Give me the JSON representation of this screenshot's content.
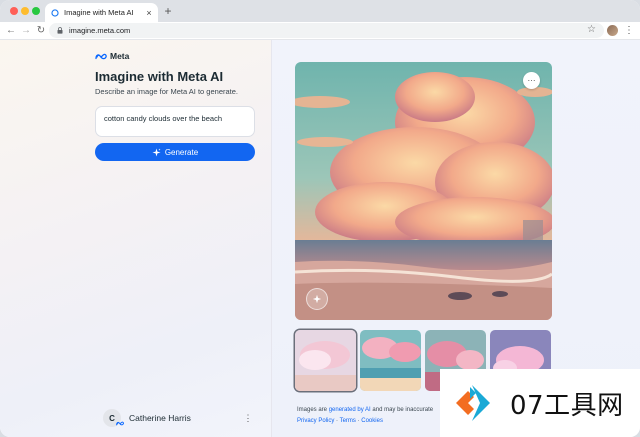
{
  "browser": {
    "tab_title": "Imagine with Meta AI",
    "tab_close": "×",
    "new_tab": "+",
    "url": "imagine.meta.com",
    "nav": {
      "back": "←",
      "forward": "→",
      "reload": "↻"
    },
    "star": "☆",
    "menu": "⋮"
  },
  "sidebar": {
    "logo_text": "Meta",
    "heading": "Imagine with Meta AI",
    "subtitle": "Describe an image for Meta AI to generate.",
    "prompt_value": "cotton candy clouds over the beach",
    "generate_label": "Generate",
    "user": {
      "initial": "C",
      "name": "Catherine Harris",
      "menu": "⋮"
    }
  },
  "viewer": {
    "more_label": "···",
    "thumbnails": [
      {
        "name": "thumbnail-1",
        "selected": true
      },
      {
        "name": "thumbnail-2",
        "selected": false
      },
      {
        "name": "thumbnail-3",
        "selected": false
      },
      {
        "name": "thumbnail-4",
        "selected": false
      }
    ],
    "disclaimer_pre": "Images are ",
    "disclaimer_link": "generated by AI",
    "disclaimer_post": " and may be inaccurate",
    "links": [
      "Privacy Policy",
      "Terms",
      "Cookies"
    ],
    "link_sep": " · "
  },
  "overlay_watermark": {
    "text": "07工具网"
  },
  "colors": {
    "accent": "#1266f1",
    "text": "#1c2b33"
  },
  "icons": [
    "meta-logo-icon",
    "lock-icon",
    "sparkle-icon",
    "star-icon",
    "ai-watermark-icon"
  ]
}
